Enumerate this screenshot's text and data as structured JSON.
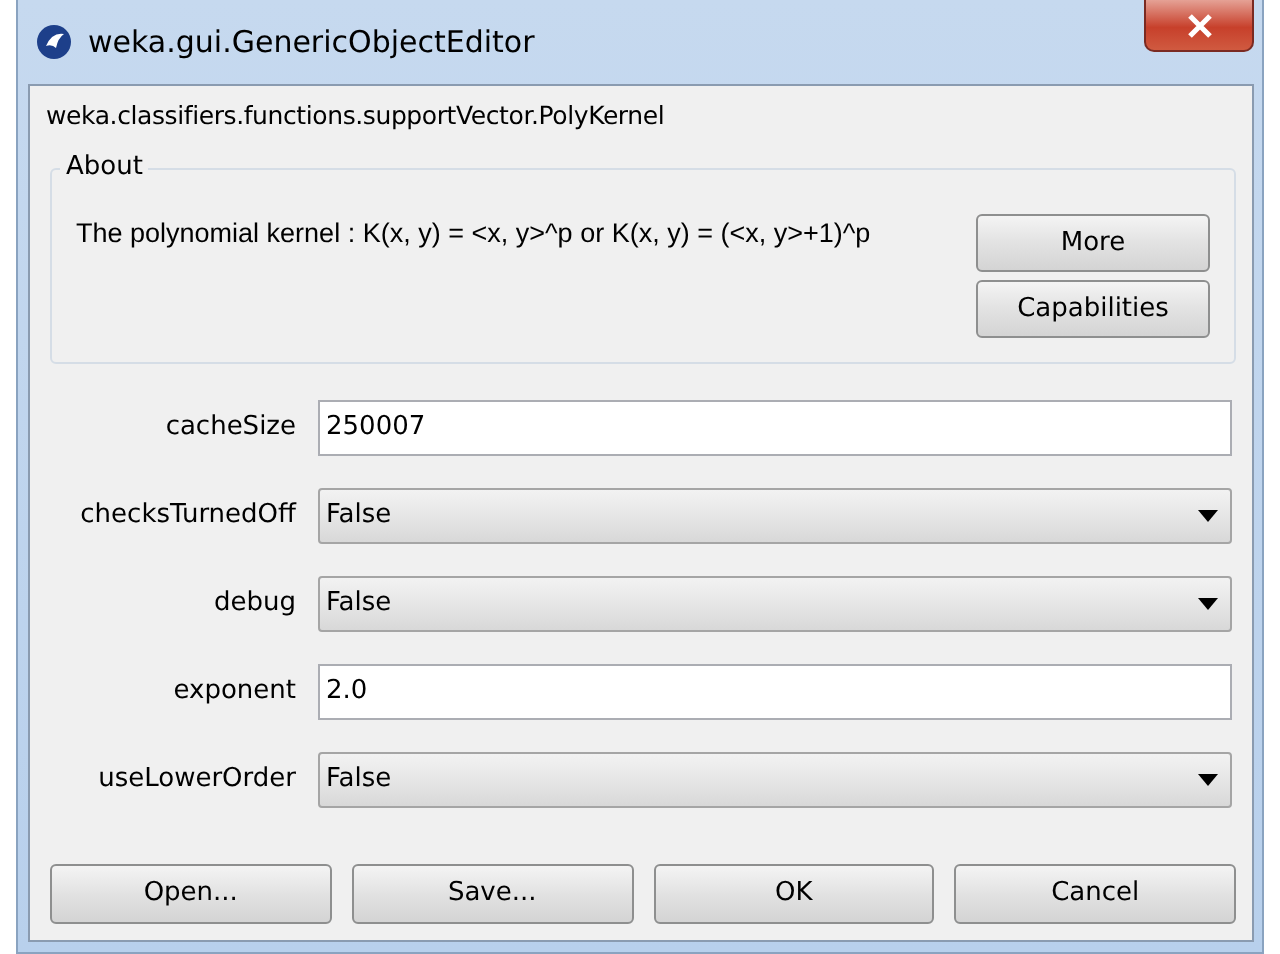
{
  "window": {
    "title": "weka.gui.GenericObjectEditor"
  },
  "class_name": "weka.classifiers.functions.supportVector.PolyKernel",
  "about": {
    "legend": "About",
    "text": "The polynomial kernel : K(x, y) = <x, y>^p or K(x, y) = (<x, y>+1)^p",
    "buttons": [
      "More",
      "Capabilities"
    ]
  },
  "properties": [
    {
      "label": "cacheSize",
      "kind": "text",
      "value": "250007"
    },
    {
      "label": "checksTurnedOff",
      "kind": "combo",
      "value": "False"
    },
    {
      "label": "debug",
      "kind": "combo",
      "value": "False"
    },
    {
      "label": "exponent",
      "kind": "text",
      "value": "2.0"
    },
    {
      "label": "useLowerOrder",
      "kind": "combo",
      "value": "False"
    }
  ],
  "buttons": [
    "Open...",
    "Save...",
    "OK",
    "Cancel"
  ]
}
